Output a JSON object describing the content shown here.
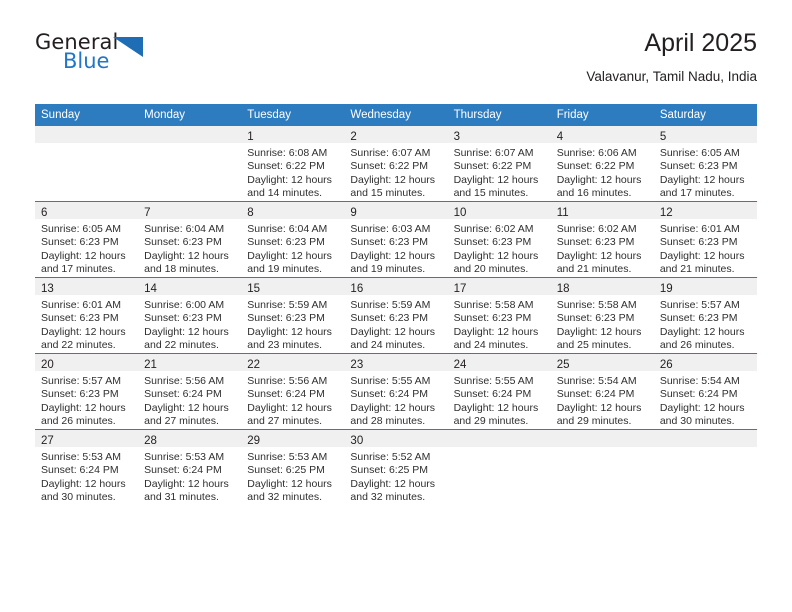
{
  "brand": {
    "name_part1": "General",
    "name_part2": "Blue",
    "triangle_color": "#1f6db5",
    "accent_color": "#2e7cc0"
  },
  "header": {
    "title": "April 2025",
    "subtitle": "Valavanur, Tamil Nadu, India"
  },
  "weekdays": [
    "Sunday",
    "Monday",
    "Tuesday",
    "Wednesday",
    "Thursday",
    "Friday",
    "Saturday"
  ],
  "weeks": [
    [
      {
        "day": "",
        "sunrise": "",
        "sunset": "",
        "daylight1": "",
        "daylight2": ""
      },
      {
        "day": "",
        "sunrise": "",
        "sunset": "",
        "daylight1": "",
        "daylight2": ""
      },
      {
        "day": "1",
        "sunrise": "Sunrise: 6:08 AM",
        "sunset": "Sunset: 6:22 PM",
        "daylight1": "Daylight: 12 hours",
        "daylight2": "and 14 minutes."
      },
      {
        "day": "2",
        "sunrise": "Sunrise: 6:07 AM",
        "sunset": "Sunset: 6:22 PM",
        "daylight1": "Daylight: 12 hours",
        "daylight2": "and 15 minutes."
      },
      {
        "day": "3",
        "sunrise": "Sunrise: 6:07 AM",
        "sunset": "Sunset: 6:22 PM",
        "daylight1": "Daylight: 12 hours",
        "daylight2": "and 15 minutes."
      },
      {
        "day": "4",
        "sunrise": "Sunrise: 6:06 AM",
        "sunset": "Sunset: 6:22 PM",
        "daylight1": "Daylight: 12 hours",
        "daylight2": "and 16 minutes."
      },
      {
        "day": "5",
        "sunrise": "Sunrise: 6:05 AM",
        "sunset": "Sunset: 6:23 PM",
        "daylight1": "Daylight: 12 hours",
        "daylight2": "and 17 minutes."
      }
    ],
    [
      {
        "day": "6",
        "sunrise": "Sunrise: 6:05 AM",
        "sunset": "Sunset: 6:23 PM",
        "daylight1": "Daylight: 12 hours",
        "daylight2": "and 17 minutes."
      },
      {
        "day": "7",
        "sunrise": "Sunrise: 6:04 AM",
        "sunset": "Sunset: 6:23 PM",
        "daylight1": "Daylight: 12 hours",
        "daylight2": "and 18 minutes."
      },
      {
        "day": "8",
        "sunrise": "Sunrise: 6:04 AM",
        "sunset": "Sunset: 6:23 PM",
        "daylight1": "Daylight: 12 hours",
        "daylight2": "and 19 minutes."
      },
      {
        "day": "9",
        "sunrise": "Sunrise: 6:03 AM",
        "sunset": "Sunset: 6:23 PM",
        "daylight1": "Daylight: 12 hours",
        "daylight2": "and 19 minutes."
      },
      {
        "day": "10",
        "sunrise": "Sunrise: 6:02 AM",
        "sunset": "Sunset: 6:23 PM",
        "daylight1": "Daylight: 12 hours",
        "daylight2": "and 20 minutes."
      },
      {
        "day": "11",
        "sunrise": "Sunrise: 6:02 AM",
        "sunset": "Sunset: 6:23 PM",
        "daylight1": "Daylight: 12 hours",
        "daylight2": "and 21 minutes."
      },
      {
        "day": "12",
        "sunrise": "Sunrise: 6:01 AM",
        "sunset": "Sunset: 6:23 PM",
        "daylight1": "Daylight: 12 hours",
        "daylight2": "and 21 minutes."
      }
    ],
    [
      {
        "day": "13",
        "sunrise": "Sunrise: 6:01 AM",
        "sunset": "Sunset: 6:23 PM",
        "daylight1": "Daylight: 12 hours",
        "daylight2": "and 22 minutes."
      },
      {
        "day": "14",
        "sunrise": "Sunrise: 6:00 AM",
        "sunset": "Sunset: 6:23 PM",
        "daylight1": "Daylight: 12 hours",
        "daylight2": "and 22 minutes."
      },
      {
        "day": "15",
        "sunrise": "Sunrise: 5:59 AM",
        "sunset": "Sunset: 6:23 PM",
        "daylight1": "Daylight: 12 hours",
        "daylight2": "and 23 minutes."
      },
      {
        "day": "16",
        "sunrise": "Sunrise: 5:59 AM",
        "sunset": "Sunset: 6:23 PM",
        "daylight1": "Daylight: 12 hours",
        "daylight2": "and 24 minutes."
      },
      {
        "day": "17",
        "sunrise": "Sunrise: 5:58 AM",
        "sunset": "Sunset: 6:23 PM",
        "daylight1": "Daylight: 12 hours",
        "daylight2": "and 24 minutes."
      },
      {
        "day": "18",
        "sunrise": "Sunrise: 5:58 AM",
        "sunset": "Sunset: 6:23 PM",
        "daylight1": "Daylight: 12 hours",
        "daylight2": "and 25 minutes."
      },
      {
        "day": "19",
        "sunrise": "Sunrise: 5:57 AM",
        "sunset": "Sunset: 6:23 PM",
        "daylight1": "Daylight: 12 hours",
        "daylight2": "and 26 minutes."
      }
    ],
    [
      {
        "day": "20",
        "sunrise": "Sunrise: 5:57 AM",
        "sunset": "Sunset: 6:23 PM",
        "daylight1": "Daylight: 12 hours",
        "daylight2": "and 26 minutes."
      },
      {
        "day": "21",
        "sunrise": "Sunrise: 5:56 AM",
        "sunset": "Sunset: 6:24 PM",
        "daylight1": "Daylight: 12 hours",
        "daylight2": "and 27 minutes."
      },
      {
        "day": "22",
        "sunrise": "Sunrise: 5:56 AM",
        "sunset": "Sunset: 6:24 PM",
        "daylight1": "Daylight: 12 hours",
        "daylight2": "and 27 minutes."
      },
      {
        "day": "23",
        "sunrise": "Sunrise: 5:55 AM",
        "sunset": "Sunset: 6:24 PM",
        "daylight1": "Daylight: 12 hours",
        "daylight2": "and 28 minutes."
      },
      {
        "day": "24",
        "sunrise": "Sunrise: 5:55 AM",
        "sunset": "Sunset: 6:24 PM",
        "daylight1": "Daylight: 12 hours",
        "daylight2": "and 29 minutes."
      },
      {
        "day": "25",
        "sunrise": "Sunrise: 5:54 AM",
        "sunset": "Sunset: 6:24 PM",
        "daylight1": "Daylight: 12 hours",
        "daylight2": "and 29 minutes."
      },
      {
        "day": "26",
        "sunrise": "Sunrise: 5:54 AM",
        "sunset": "Sunset: 6:24 PM",
        "daylight1": "Daylight: 12 hours",
        "daylight2": "and 30 minutes."
      }
    ],
    [
      {
        "day": "27",
        "sunrise": "Sunrise: 5:53 AM",
        "sunset": "Sunset: 6:24 PM",
        "daylight1": "Daylight: 12 hours",
        "daylight2": "and 30 minutes."
      },
      {
        "day": "28",
        "sunrise": "Sunrise: 5:53 AM",
        "sunset": "Sunset: 6:24 PM",
        "daylight1": "Daylight: 12 hours",
        "daylight2": "and 31 minutes."
      },
      {
        "day": "29",
        "sunrise": "Sunrise: 5:53 AM",
        "sunset": "Sunset: 6:25 PM",
        "daylight1": "Daylight: 12 hours",
        "daylight2": "and 32 minutes."
      },
      {
        "day": "30",
        "sunrise": "Sunrise: 5:52 AM",
        "sunset": "Sunset: 6:25 PM",
        "daylight1": "Daylight: 12 hours",
        "daylight2": "and 32 minutes."
      },
      {
        "day": "",
        "sunrise": "",
        "sunset": "",
        "daylight1": "",
        "daylight2": ""
      },
      {
        "day": "",
        "sunrise": "",
        "sunset": "",
        "daylight1": "",
        "daylight2": ""
      },
      {
        "day": "",
        "sunrise": "",
        "sunset": "",
        "daylight1": "",
        "daylight2": ""
      }
    ]
  ]
}
